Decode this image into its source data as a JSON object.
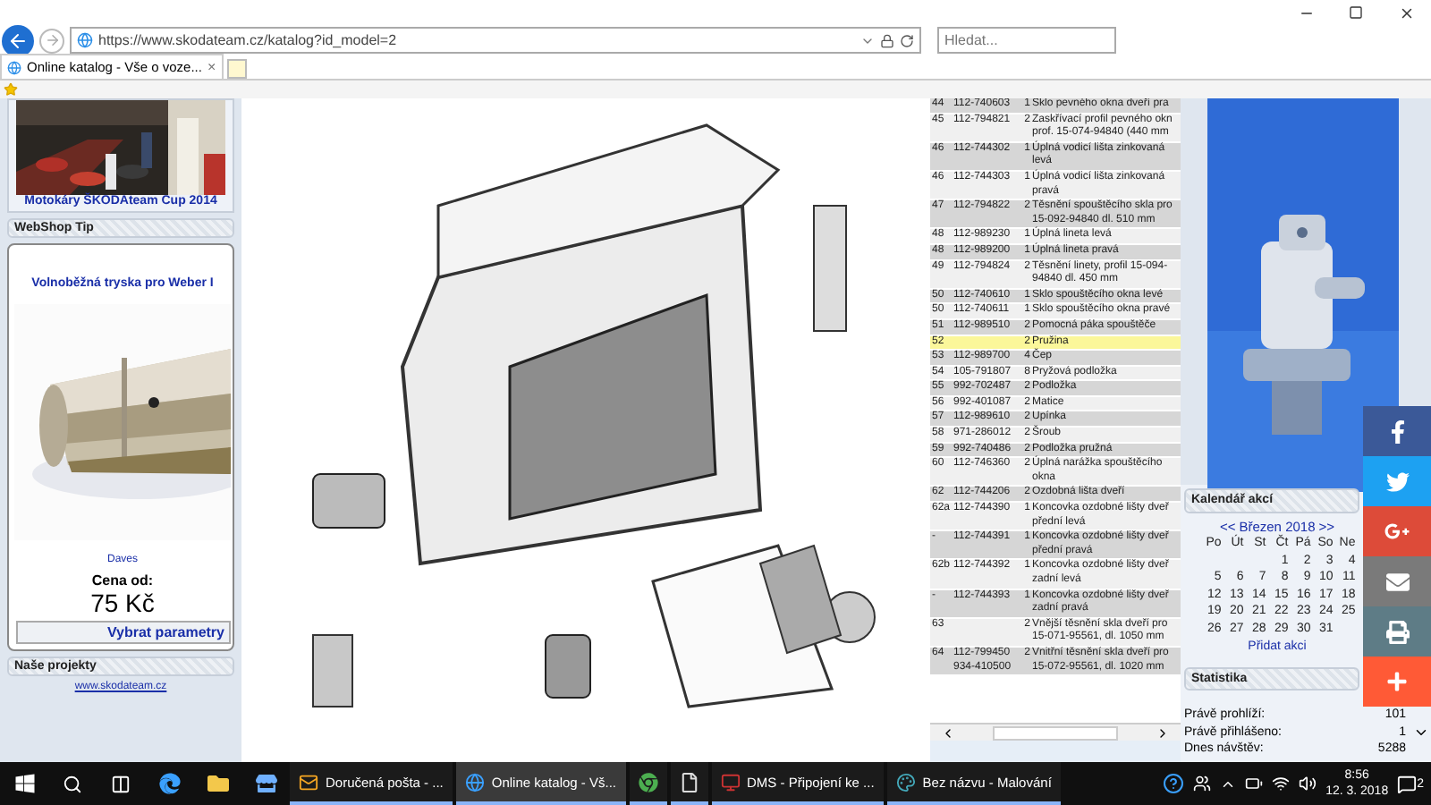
{
  "browser": {
    "url": "https://www.skodateam.cz/katalog?id_model=2",
    "search_placeholder": "Hledat...",
    "tabs": [
      {
        "title": "Online katalog - Vše o voze...",
        "close": "×",
        "selected": true
      }
    ]
  },
  "left": {
    "photo_caption": "Motokáry ŠKODAteam Cup 2014",
    "webshop": {
      "heading": "WebShop Tip",
      "product": "Volnoběžná tryska pro Weber I",
      "seller": "Daves",
      "price_label": "Cena od:",
      "price": "75 Kč",
      "button": "Vybrat parametry"
    },
    "projects": {
      "heading": "Naše projekty",
      "link": "www.skodateam.cz"
    }
  },
  "parts": [
    {
      "no": "44",
      "part": "112-740603",
      "qty": "1",
      "description": [
        "Sklo pevného okna dveří pra"
      ],
      "selected": false
    },
    {
      "no": "45",
      "part": "112-794821",
      "qty": "2",
      "description": [
        "Zaskřívací profil pevného okn",
        "prof. 15-074-94840 (440 mm"
      ],
      "selected": false
    },
    {
      "no": "46",
      "part": "112-744302",
      "qty": "1",
      "description": [
        "Úplná vodicí lišta zinkovaná",
        "levá"
      ],
      "selected": false
    },
    {
      "no": "46",
      "part": "112-744303",
      "qty": "1",
      "description": [
        "Úplná vodicí lišta zinkovaná",
        "pravá"
      ],
      "selected": false
    },
    {
      "no": "47",
      "part": "112-794822",
      "qty": "2",
      "description": [
        "Těsnění spouštěcího skla pro",
        "15-092-94840 dl. 510 mm"
      ],
      "selected": false
    },
    {
      "no": "48",
      "part": "112-989230",
      "qty": "1",
      "description": [
        "Úplná lineta levá"
      ],
      "selected": false
    },
    {
      "no": "48",
      "part": "112-989200",
      "qty": "1",
      "description": [
        "Úplná lineta pravá"
      ],
      "selected": false
    },
    {
      "no": "49",
      "part": "112-794824",
      "qty": "2",
      "description": [
        "Těsnění linety, profil 15-094-",
        "94840 dl. 450 mm"
      ],
      "selected": false
    },
    {
      "no": "50",
      "part": "112-740610",
      "qty": "1",
      "description": [
        "Sklo spouštěcího okna levé"
      ],
      "selected": false
    },
    {
      "no": "50",
      "part": "112-740611",
      "qty": "1",
      "description": [
        "Sklo spouštěcího okna pravé"
      ],
      "selected": false
    },
    {
      "no": "51",
      "part": "112-989510",
      "qty": "2",
      "description": [
        "Pomocná páka spouštěče"
      ],
      "selected": false
    },
    {
      "no": "52",
      "qty": "2",
      "description": [
        "Pružina"
      ],
      "selected": true
    },
    {
      "no": "53",
      "part": "112-989700",
      "qty": "4",
      "description": [
        "Čep"
      ],
      "selected": false
    },
    {
      "no": "54",
      "part": "105-791807",
      "qty": "8",
      "description": [
        "Pryžová podložka"
      ],
      "selected": false
    },
    {
      "no": "55",
      "part": "992-702487",
      "qty": "2",
      "description": [
        "Podložka"
      ],
      "selected": false
    },
    {
      "no": "56",
      "part": "992-401087",
      "qty": "2",
      "description": [
        "Matice"
      ],
      "selected": false
    },
    {
      "no": "57",
      "part": "112-989610",
      "qty": "2",
      "description": [
        "Upínka"
      ],
      "selected": false
    },
    {
      "no": "58",
      "part": "971-286012",
      "qty": "2",
      "description": [
        "Šroub"
      ],
      "selected": false
    },
    {
      "no": "59",
      "part": "992-740486",
      "qty": "2",
      "description": [
        "Podložka pružná"
      ],
      "selected": false
    },
    {
      "no": "60",
      "part": "112-746360",
      "qty": "2",
      "description": [
        "Úplná narážka spouštěcího",
        "okna"
      ],
      "selected": false
    },
    {
      "no": "62",
      "part": "112-744206",
      "qty": "2",
      "description": [
        "Ozdobná lišta dveří"
      ],
      "selected": false
    },
    {
      "no": "62a",
      "part": "112-744390",
      "qty": "1",
      "description": [
        "Koncovka ozdobné lišty dveř",
        "přední levá"
      ],
      "selected": false
    },
    {
      "no": "-",
      "part": "112-744391",
      "qty": "1",
      "description": [
        "Koncovka ozdobné lišty dveř",
        "přední pravá"
      ],
      "selected": false
    },
    {
      "no": "62b",
      "part": "112-744392",
      "qty": "1",
      "description": [
        "Koncovka ozdobné lišty dveř",
        "zadní levá"
      ],
      "selected": false
    },
    {
      "no": "-",
      "part": "112-744393",
      "qty": "1",
      "description": [
        "Koncovka ozdobné lišty dveř",
        "zadní pravá"
      ],
      "selected": false
    },
    {
      "no": "63",
      "qty": "2",
      "description": [
        "Vnější těsnění skla dveří pro",
        "15-071-95561, dl. 1050 mm"
      ],
      "selected": false
    },
    {
      "no": "64",
      "part": "112-799450 934-410500",
      "qty": "2",
      "description": [
        "Vnitřní těsnění skla dveří pro",
        "15-072-95561, dl. 1020 mm"
      ],
      "selected": false
    }
  ],
  "calendar": {
    "heading": "Kalendář akcí",
    "prev": "<<",
    "month": "Březen 2018",
    "next": ">>",
    "weekdays": [
      "Po",
      "Út",
      "St",
      "Čt",
      "Pá",
      "So",
      "Ne"
    ],
    "weeks": [
      [
        "1",
        "2",
        "3",
        "4"
      ],
      [
        "5",
        "6",
        "7",
        "8",
        "9",
        "10",
        "11"
      ],
      [
        "12",
        "13",
        "14",
        "15",
        "16",
        "17",
        "18"
      ],
      [
        "19",
        "20",
        "21",
        "22",
        "23",
        "24",
        "25"
      ],
      [
        "26",
        "27",
        "28",
        "29",
        "30",
        "31"
      ]
    ],
    "add": "Přidat akci"
  },
  "statistics": {
    "heading": "Statistika",
    "rows": [
      {
        "label": "Právě prohlíží:",
        "value": "101"
      },
      {
        "label": "Právě přihlášeno:",
        "value": "1"
      },
      {
        "label": "Dnes návštěv:",
        "value": "5288"
      }
    ]
  },
  "share": [
    {
      "kind": "facebook",
      "color": "#3b5998"
    },
    {
      "kind": "twitter",
      "color": "#1da1f2"
    },
    {
      "kind": "googleplus",
      "color": "#dd4b39"
    },
    {
      "kind": "mail",
      "color": "#7a7a7a"
    },
    {
      "kind": "print",
      "color": "#5e7c86"
    },
    {
      "kind": "more",
      "color": "#ff5a36"
    }
  ],
  "taskbar": {
    "apps": [
      {
        "kind": "outlook",
        "label": "Doručená pošta - ...",
        "selected": false
      },
      {
        "kind": "ie",
        "label": "Online katalog - Vš...",
        "selected": true
      },
      {
        "kind": "chrome",
        "selected": false
      },
      {
        "kind": "file",
        "selected": false
      },
      {
        "kind": "dms",
        "label": "DMS - Připojení ke ...",
        "selected": false
      },
      {
        "kind": "paint",
        "label": "Bez názvu - Malování",
        "selected": false
      }
    ],
    "time": "8:56",
    "date": "12. 3. 2018",
    "notifications": "2"
  }
}
